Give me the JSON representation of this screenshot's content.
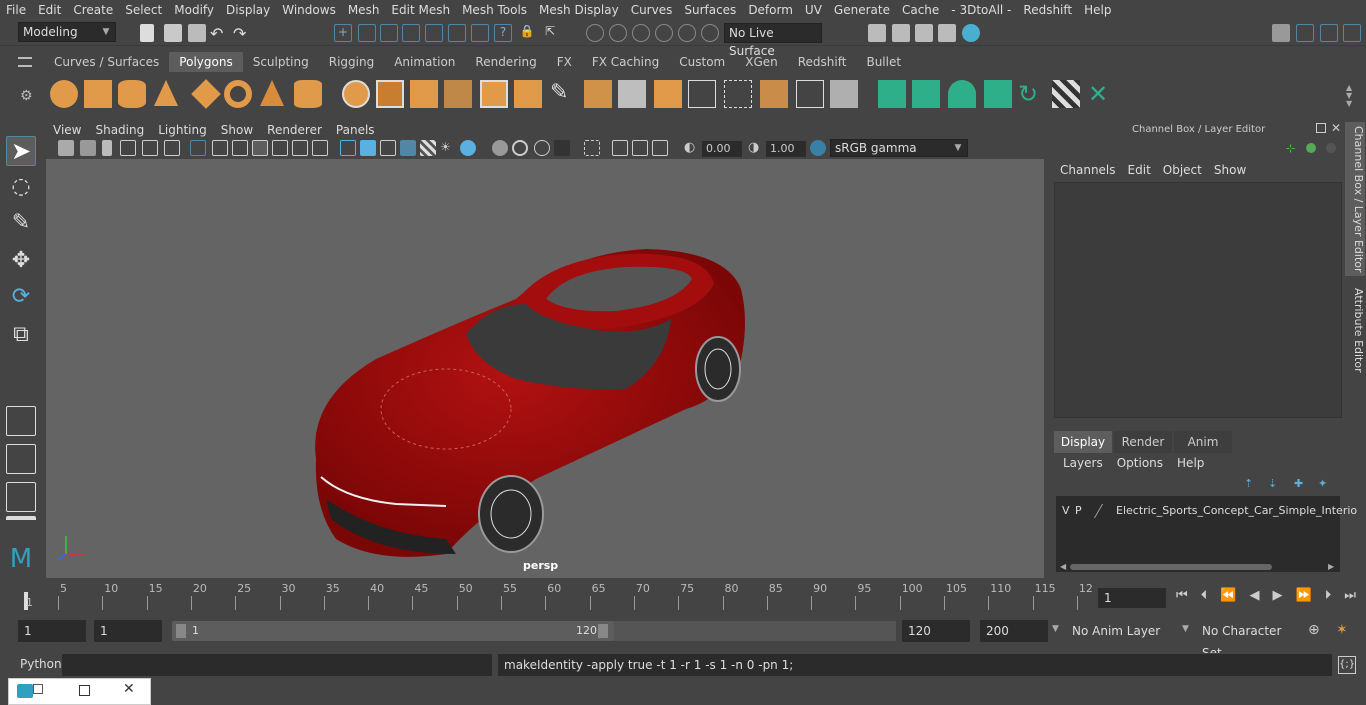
{
  "menu": [
    "File",
    "Edit",
    "Create",
    "Select",
    "Modify",
    "Display",
    "Windows",
    "Mesh",
    "Edit Mesh",
    "Mesh Tools",
    "Mesh Display",
    "Curves",
    "Surfaces",
    "Deform",
    "UV",
    "Generate",
    "Cache",
    "- 3DtoAll -",
    "Redshift",
    "Help"
  ],
  "status": {
    "mode": "Modeling",
    "live_surface": "No Live Surface"
  },
  "shelf_tabs": [
    "Curves / Surfaces",
    "Polygons",
    "Sculpting",
    "Rigging",
    "Animation",
    "Rendering",
    "FX",
    "FX Caching",
    "Custom",
    "XGen",
    "Redshift",
    "Bullet"
  ],
  "viewport": {
    "menu": [
      "View",
      "Shading",
      "Lighting",
      "Show",
      "Renderer",
      "Panels"
    ],
    "exposure": "0.00",
    "gamma": "1.00",
    "color_space": "sRGB gamma",
    "camera_label": "persp"
  },
  "channel_box": {
    "title": "Channel Box / Layer Editor",
    "menu": [
      "Channels",
      "Edit",
      "Object",
      "Show"
    ],
    "side_tab_1": "Channel Box / Layer Editor",
    "side_tab_2": "Attribute Editor"
  },
  "layer_editor": {
    "tabs": [
      "Display",
      "Render",
      "Anim"
    ],
    "menu": [
      "Layers",
      "Options",
      "Help"
    ],
    "layer": {
      "v": "V",
      "p": "P",
      "name": "Electric_Sports_Concept_Car_Simple_Interio"
    }
  },
  "timeline": {
    "ticks": [
      "5",
      "10",
      "15",
      "20",
      "25",
      "30",
      "35",
      "40",
      "45",
      "50",
      "55",
      "60",
      "65",
      "70",
      "75",
      "80",
      "85",
      "90",
      "95",
      "100",
      "105",
      "110",
      "115",
      "12"
    ],
    "start_marker": "1",
    "current_frame": "1"
  },
  "range": {
    "start": "1",
    "start2": "1",
    "slider_start": "1",
    "slider_end": "120",
    "end": "120",
    "total_end": "200",
    "anim_layer": "No Anim Layer",
    "char_set": "No Character Set"
  },
  "command": {
    "language": "Python",
    "result": "makeIdentity -apply true -t 1 -r 1 -s 1 -n 0 -pn 1;"
  },
  "colors": {
    "accent": "#5285a6",
    "car_red": "#a30d0d",
    "shelf_teal": "#2fae8a",
    "shelf_orange": "#e09a4a"
  }
}
